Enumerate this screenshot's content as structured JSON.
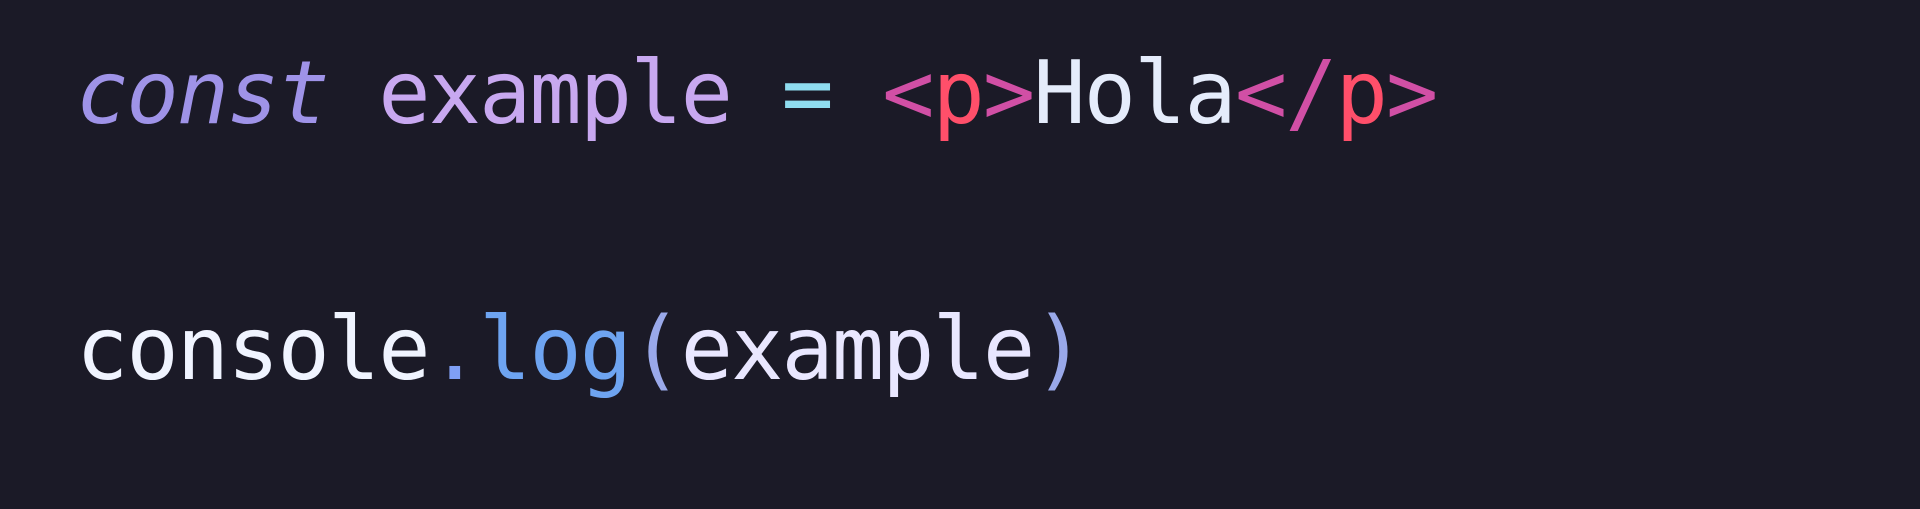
{
  "editor": {
    "background": "#1b1a27",
    "lines": [
      {
        "tokens": [
          {
            "text": "const",
            "role": "keyword",
            "color": "#9f93e8"
          },
          {
            "text": " ",
            "role": "space"
          },
          {
            "text": "example",
            "role": "identifier",
            "color": "#c8a8f0"
          },
          {
            "text": " ",
            "role": "space"
          },
          {
            "text": "=",
            "role": "operator",
            "color": "#8fdcef"
          },
          {
            "text": " ",
            "role": "space"
          },
          {
            "text": "<",
            "role": "tag-bracket",
            "color": "#d14fa5"
          },
          {
            "text": "p",
            "role": "tag-name",
            "color": "#ff4f6a"
          },
          {
            "text": ">",
            "role": "tag-bracket",
            "color": "#d14fa5"
          },
          {
            "text": "Hola",
            "role": "text-content",
            "color": "#e5ecfb"
          },
          {
            "text": "</",
            "role": "tag-bracket",
            "color": "#d14fa5"
          },
          {
            "text": "p",
            "role": "tag-name",
            "color": "#ff4f6a"
          },
          {
            "text": ">",
            "role": "tag-bracket",
            "color": "#d14fa5"
          }
        ]
      },
      {
        "tokens": [
          {
            "text": "console",
            "role": "object",
            "color": "#f0f4ff"
          },
          {
            "text": ".",
            "role": "dot",
            "color": "#7f9ff5"
          },
          {
            "text": "log",
            "role": "method",
            "color": "#6ea4f1"
          },
          {
            "text": "(",
            "role": "paren",
            "color": "#9aa9ea"
          },
          {
            "text": "example",
            "role": "argument",
            "color": "#e9e7ff"
          },
          {
            "text": ")",
            "role": "paren",
            "color": "#9aa9ea"
          }
        ]
      }
    ]
  }
}
